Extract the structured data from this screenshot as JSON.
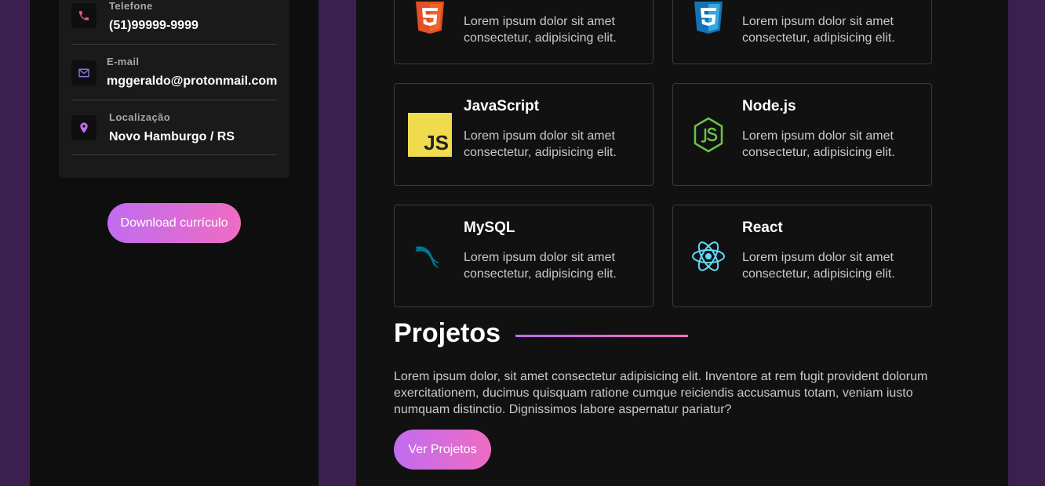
{
  "sidebar": {
    "contacts": [
      {
        "label": "Telefone",
        "value": "(51)99999-9999",
        "icon": "phone-icon",
        "icon_color": "#ef4c8f"
      },
      {
        "label": "E-mail",
        "value": "mggeraldo@protonmail.com",
        "icon": "mail-icon",
        "icon_color": "#8a7cf0"
      },
      {
        "label": "Localização",
        "value": "Novo Hamburgo / RS",
        "icon": "location-pin-icon",
        "icon_color": "#c06cf0"
      }
    ],
    "download_label": "Download currículo"
  },
  "skills": [
    {
      "name": "",
      "description": "Lorem ipsum dolor sit amet consectetur, adipisicing elit.",
      "icon": "html5-icon"
    },
    {
      "name": "",
      "description": "Lorem ipsum dolor sit amet consectetur, adipisicing elit.",
      "icon": "css3-icon"
    },
    {
      "name": "JavaScript",
      "description": "Lorem ipsum dolor sit amet consectetur, adipisicing elit.",
      "icon": "javascript-icon"
    },
    {
      "name": "Node.js",
      "description": "Lorem ipsum dolor sit amet consectetur, adipisicing elit.",
      "icon": "nodejs-icon"
    },
    {
      "name": "MySQL",
      "description": "Lorem ipsum dolor sit amet consectetur, adipisicing elit.",
      "icon": "mysql-icon"
    },
    {
      "name": "React",
      "description": "Lorem ipsum dolor sit amet consectetur, adipisicing elit.",
      "icon": "react-icon"
    }
  ],
  "projects": {
    "title": "Projetos",
    "paragraph": "Lorem ipsum dolor, sit amet consectetur adipisicing elit. Inventore at rem fugit provident dolorum exercitationem, ducimus quisquam ratione cumque reiciendis accusamus totam, veniam iusto numquam distinctio. Dignissimos labore aspernatur pariatur?",
    "button_label": "Ver Projetos"
  },
  "colors": {
    "accent_start": "#c06cf0",
    "accent_end": "#ef6cc2",
    "page_bg": "#3b1f4e",
    "panel_bg": "#111111"
  },
  "logo_text": {
    "javascript": "JS"
  }
}
